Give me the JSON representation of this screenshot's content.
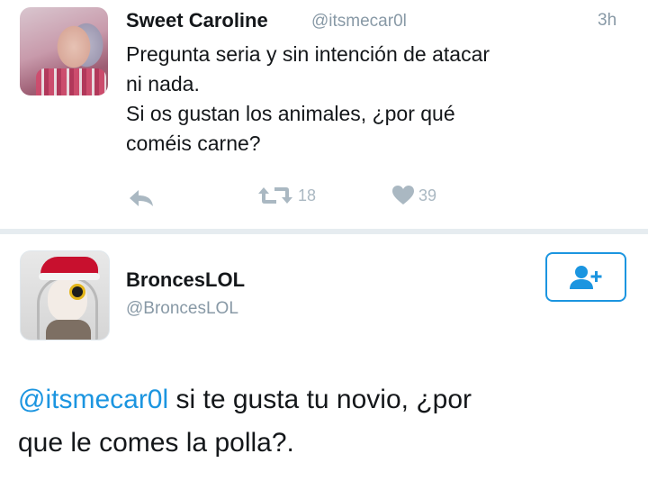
{
  "tweet": {
    "author_name": "Sweet Caroline",
    "author_handle": "@itsmecar0l",
    "timestamp": "3h",
    "text": "Pregunta seria y sin intención de atacar\nni nada.\nSi os gustan los animales, ¿por qué\ncoméis carne?",
    "retweet_count": "18",
    "like_count": "39"
  },
  "reply": {
    "author_name": "BroncesLOL",
    "author_handle": "@BroncesLOL",
    "mention": "@itsmecar0l",
    "text": " si te gusta tu novio,  ¿por\nque le comes la polla?."
  },
  "colors": {
    "accent": "#1b95e0",
    "muted": "#8899a6",
    "action_icon": "#aab8c2",
    "divider": "#e6ecf0"
  },
  "icons": [
    "reply-icon",
    "retweet-icon",
    "heart-icon",
    "follow-user-icon"
  ]
}
